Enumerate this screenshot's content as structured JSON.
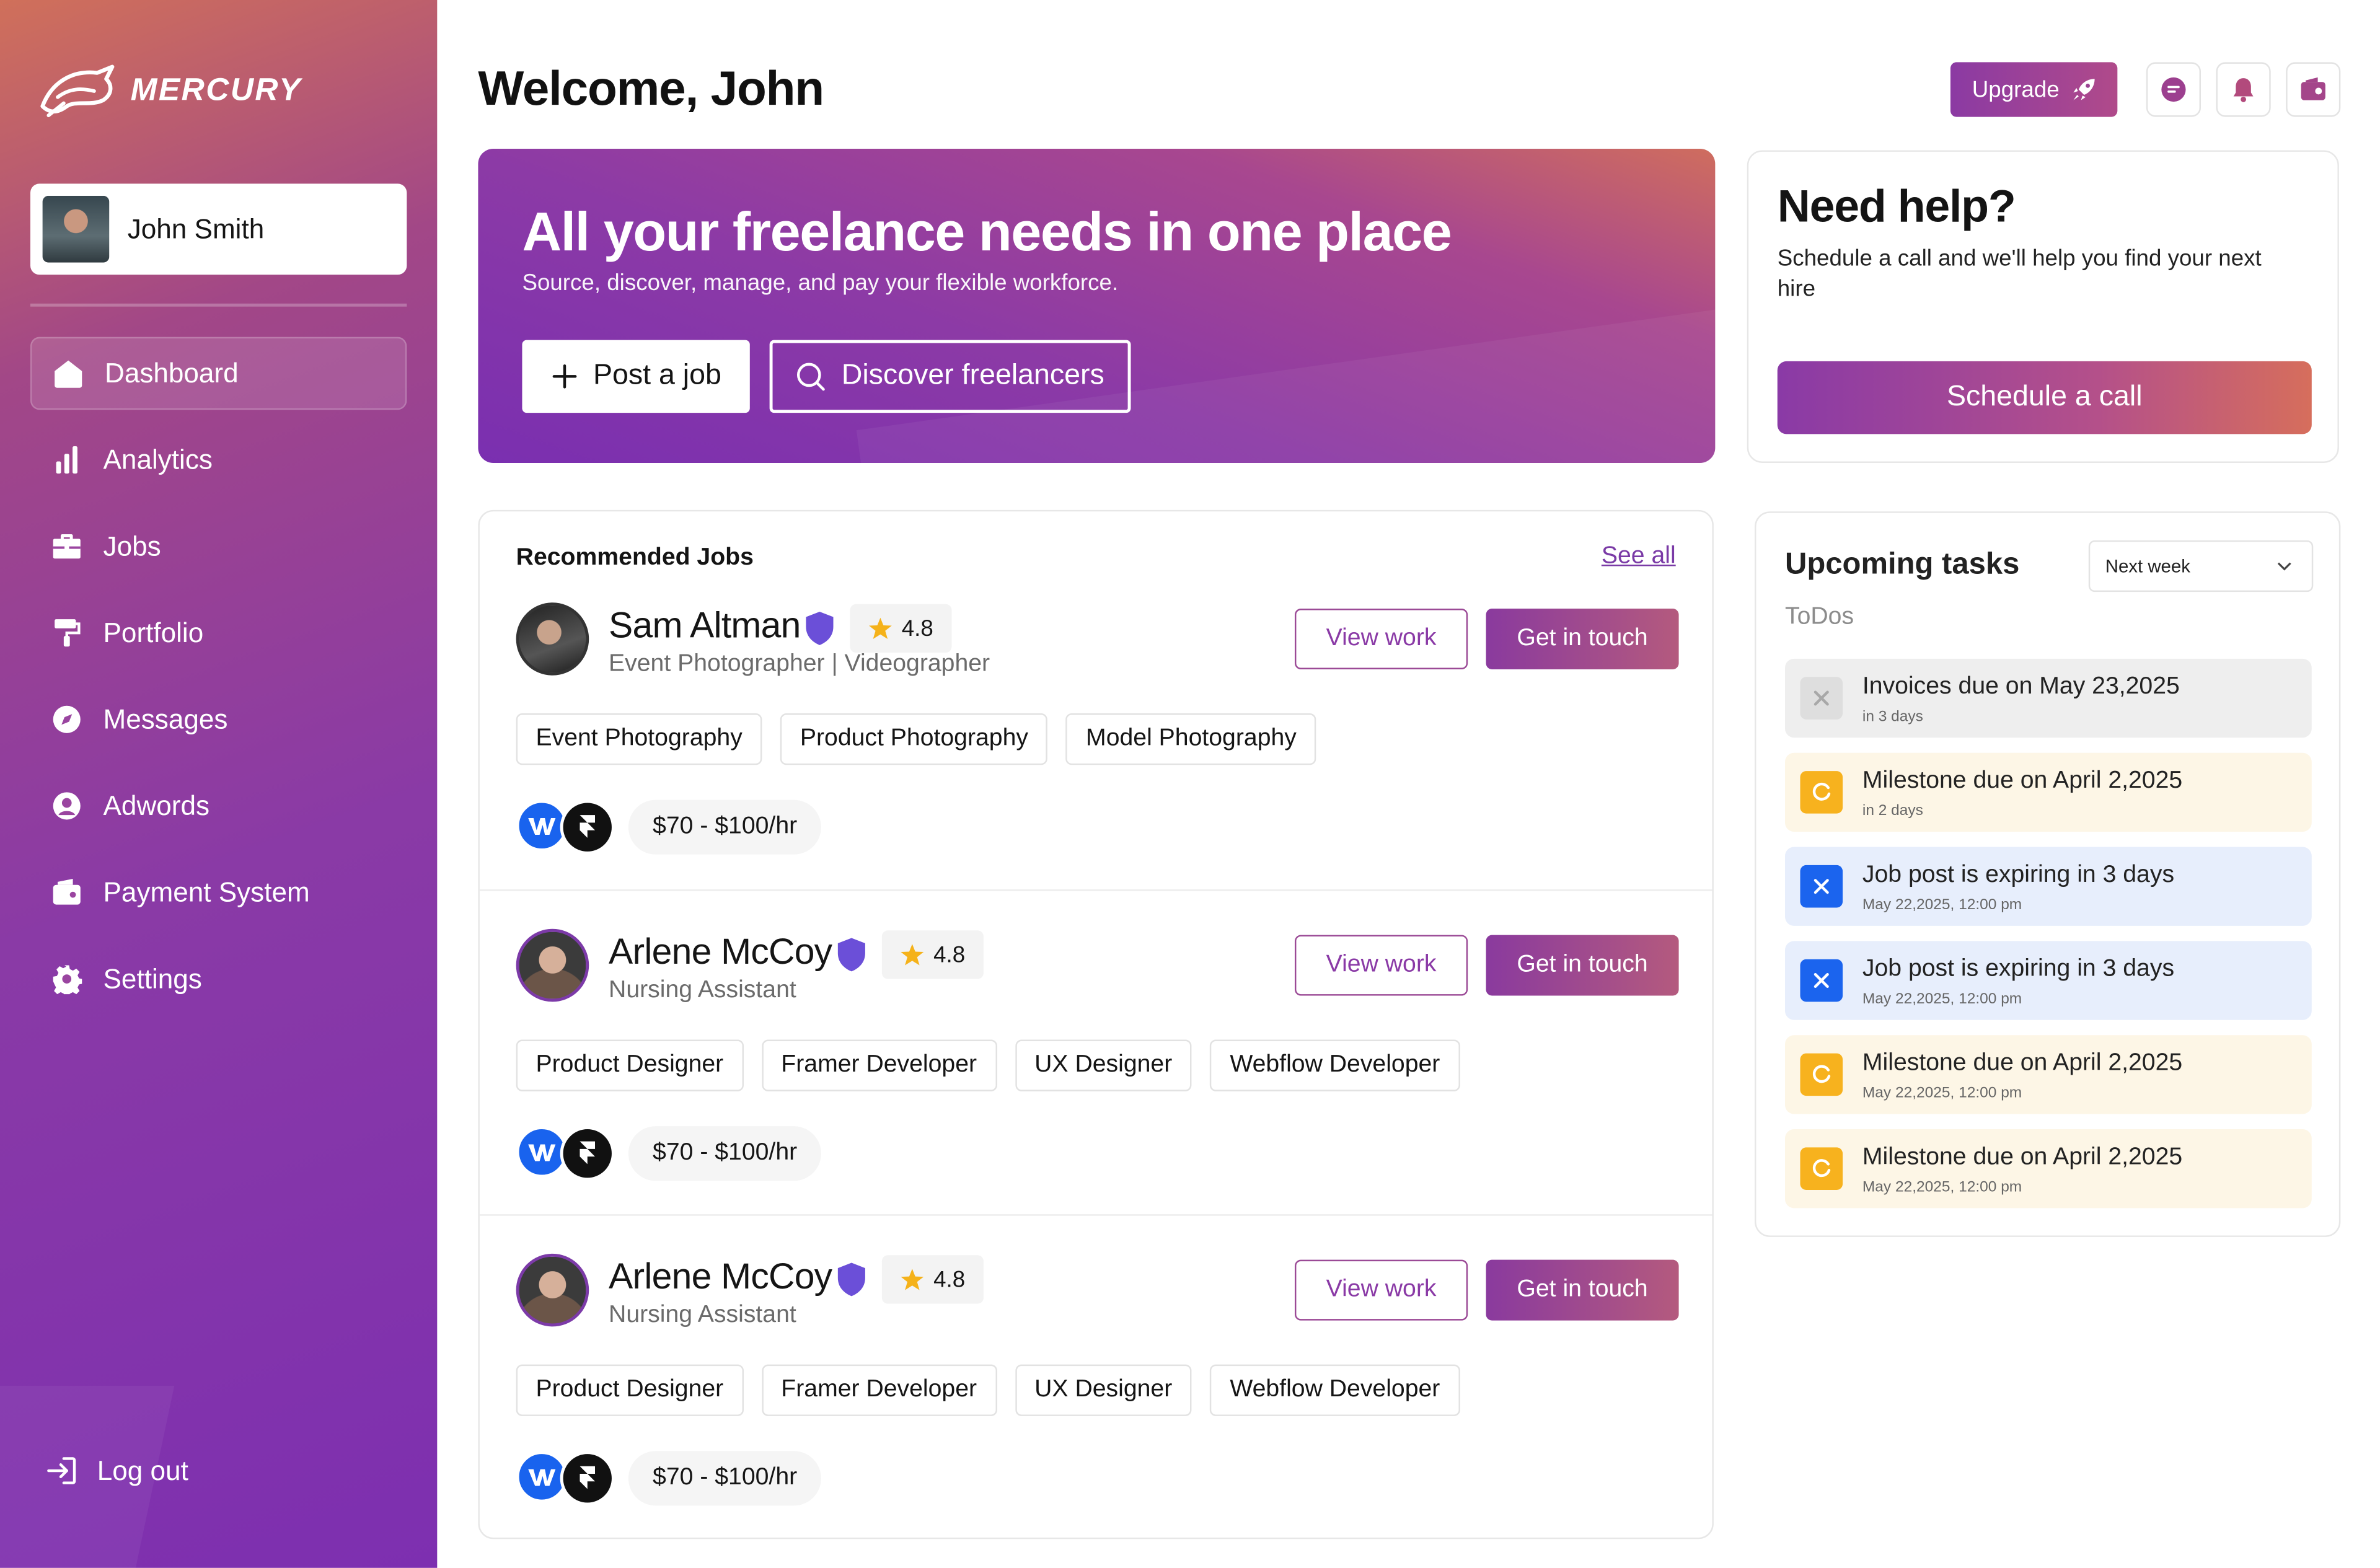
{
  "brand": {
    "name": "MERCURY"
  },
  "user": {
    "name": "John Smith"
  },
  "nav": {
    "items": [
      {
        "label": "Dashboard",
        "icon": "home-icon",
        "active": true
      },
      {
        "label": "Analytics",
        "icon": "bar-chart-icon"
      },
      {
        "label": "Jobs",
        "icon": "briefcase-icon"
      },
      {
        "label": "Portfolio",
        "icon": "paint-roller-icon"
      },
      {
        "label": "Messages",
        "icon": "compass-icon"
      },
      {
        "label": "Adwords",
        "icon": "user-circle-icon"
      },
      {
        "label": "Payment System",
        "icon": "wallet-icon"
      },
      {
        "label": "Settings",
        "icon": "gear-icon"
      }
    ],
    "logout": "Log out"
  },
  "header": {
    "welcome": "Welcome, John",
    "upgrade": "Upgrade"
  },
  "hero": {
    "title": "All your freelance needs in one place",
    "subtitle": "Source, discover, manage, and pay your flexible workforce.",
    "post_job": "Post a job",
    "discover": "Discover freelancers"
  },
  "help": {
    "title": "Need help?",
    "text": "Schedule a call and we'll help you find your next hire",
    "button": "Schedule a call"
  },
  "jobs": {
    "title": "Recommended Jobs",
    "see_all": "See all",
    "view_work": "View work",
    "get_in_touch": "Get in touch",
    "items": [
      {
        "name": "Sam Altman",
        "rating": "4.8",
        "role": "Event Photographer | Videographer",
        "skills": [
          "Event Photography",
          "Product Photography",
          "Model Photography"
        ],
        "rate": "$70 - $100/hr"
      },
      {
        "name": "Arlene McCoy",
        "rating": "4.8",
        "role": "Nursing Assistant",
        "skills": [
          "Product Designer",
          "Framer Developer",
          "UX Designer",
          "Webflow Developer"
        ],
        "rate": "$70 - $100/hr"
      },
      {
        "name": "Arlene McCoy",
        "rating": "4.8",
        "role": "Nursing Assistant",
        "skills": [
          "Product Designer",
          "Framer Developer",
          "UX Designer",
          "Webflow Developer"
        ],
        "rate": "$70 - $100/hr"
      }
    ]
  },
  "tasks": {
    "title": "Upcoming tasks",
    "filter": "Next week",
    "todos_label": "ToDos",
    "items": [
      {
        "title": "Invoices due on May 23,2025",
        "sub": "in 3 days",
        "tone": "grey"
      },
      {
        "title": "Milestone due on April 2,2025",
        "sub": "in 2 days",
        "tone": "yellow"
      },
      {
        "title": "Job post is expiring in 3 days",
        "sub": "May 22,2025, 12:00 pm",
        "tone": "blue"
      },
      {
        "title": "Job post is expiring in 3 days",
        "sub": "May 22,2025, 12:00 pm",
        "tone": "blue"
      },
      {
        "title": "Milestone due on April 2,2025",
        "sub": "May 22,2025, 12:00 pm",
        "tone": "yellow"
      },
      {
        "title": "Milestone due on April 2,2025",
        "sub": "May 22,2025, 12:00 pm",
        "tone": "yellow"
      }
    ]
  },
  "colors": {
    "brand_purple": "#8a3aa6",
    "brand_orange": "#d66e5c",
    "task_blue": "#1b64ee",
    "task_yellow": "#f7b21e"
  }
}
